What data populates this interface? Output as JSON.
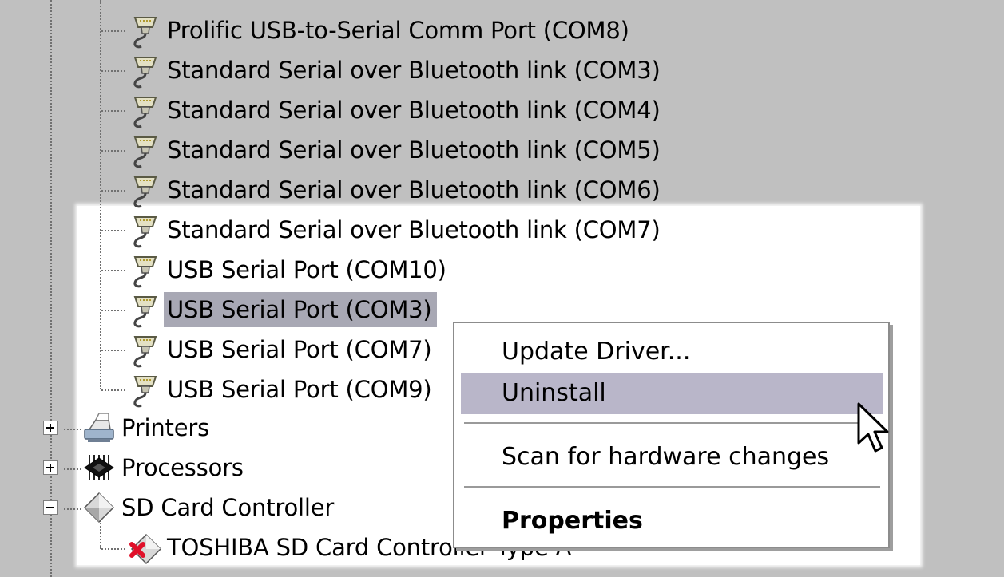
{
  "tree": {
    "ports": [
      {
        "label": "Prolific USB-to-Serial Comm Port (COM8)",
        "icon": "serial-port-icon"
      },
      {
        "label": "Standard Serial over Bluetooth link (COM3)",
        "icon": "serial-port-icon"
      },
      {
        "label": "Standard Serial over Bluetooth link (COM4)",
        "icon": "serial-port-icon"
      },
      {
        "label": "Standard Serial over Bluetooth link (COM5)",
        "icon": "serial-port-icon"
      },
      {
        "label": "Standard Serial over Bluetooth link (COM6)",
        "icon": "serial-port-icon"
      },
      {
        "label": "Standard Serial over Bluetooth link (COM7)",
        "icon": "serial-port-icon"
      },
      {
        "label": "USB Serial Port (COM10)",
        "icon": "serial-port-icon"
      },
      {
        "label": "USB Serial Port (COM3)",
        "icon": "serial-port-icon",
        "selected": true
      },
      {
        "label": "USB Serial Port (COM7)",
        "icon": "serial-port-icon"
      },
      {
        "label": "USB Serial Port (COM9)",
        "icon": "serial-port-icon"
      }
    ],
    "categories": [
      {
        "label": "Printers",
        "icon": "printer-icon",
        "expanded": false
      },
      {
        "label": "Processors",
        "icon": "processor-icon",
        "expanded": false
      },
      {
        "label": "SD Card Controller",
        "icon": "sd-card-icon",
        "expanded": true
      }
    ],
    "sd_child": {
      "label": "TOSHIBA SD Card Controller Type A",
      "icon": "disabled-device-icon"
    }
  },
  "context_menu": {
    "items": [
      {
        "label": "Update Driver...",
        "highlighted": false
      },
      {
        "label": "Uninstall",
        "highlighted": true
      },
      {
        "label": "Scan for hardware changes",
        "highlighted": false
      },
      {
        "label": "Properties",
        "bold": true
      }
    ]
  },
  "colors": {
    "background": "#c0c0c0",
    "selection": "#a8a8b4",
    "menu_highlight": "#b9b6c9"
  }
}
